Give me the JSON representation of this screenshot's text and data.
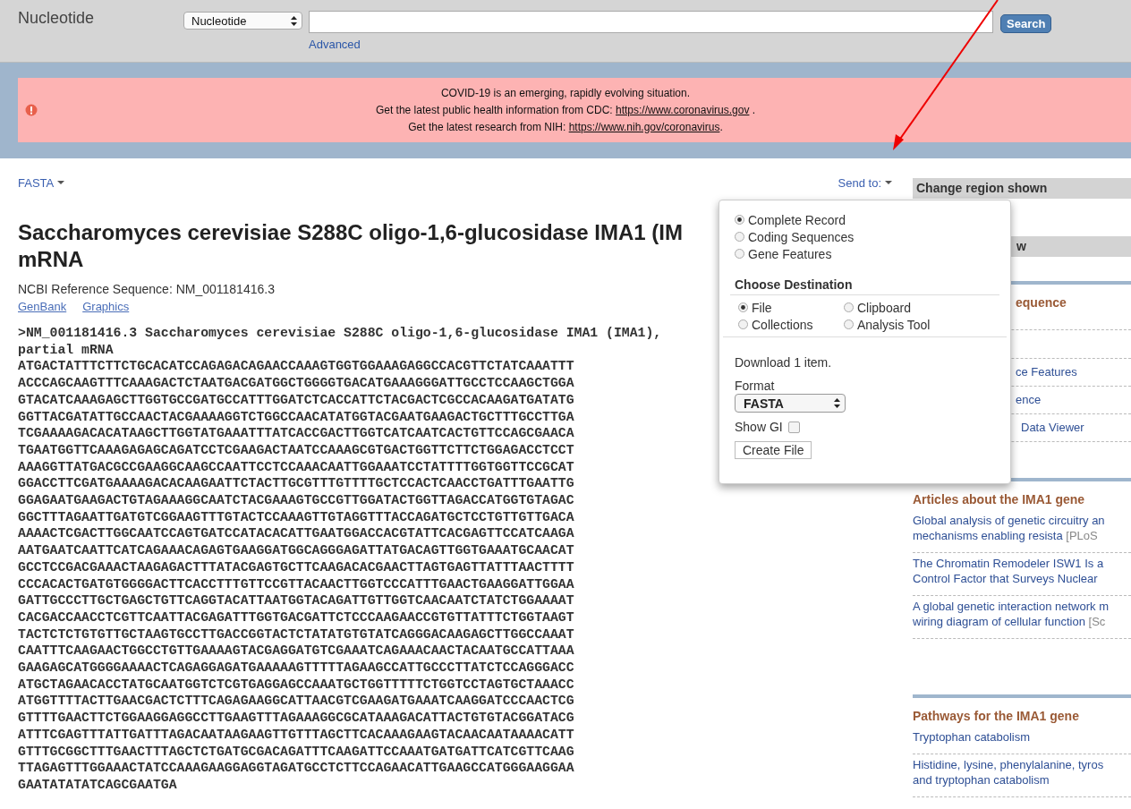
{
  "header": {
    "database": "Nucleotide",
    "db_select": "Nucleotide",
    "search_button": "Search",
    "advanced_link": "Advanced"
  },
  "alert": {
    "lines": [
      {
        "text": "COVID-19 is an emerging, rapidly evolving situation."
      },
      {
        "text": "Get the latest public health information from CDC: ",
        "link": "https://www.coronavirus.gov",
        "tail": " ."
      },
      {
        "text": "Get the latest research from NIH: ",
        "link": "https://www.nih.gov/coronavirus",
        "tail": "."
      }
    ]
  },
  "toolbar": {
    "format_menu": "FASTA",
    "send_to": "Send to:"
  },
  "record": {
    "title_lines": [
      "Saccharomyces cerevisiae S288C oligo-1,6-glucosidase IMA1 (IM",
      "mRNA"
    ],
    "reference": "NCBI Reference Sequence: NM_001181416.3",
    "links": [
      "GenBank",
      "Graphics"
    ],
    "fasta_header": [
      ">NM_001181416.3 Saccharomyces cerevisiae S288C oligo-1,6-glucosidase IMA1 (IMA1),",
      "partial mRNA"
    ],
    "sequence": [
      "ATGACTATTTCTTCTGCACATCCAGAGACAGAACCAAAGTGGTGGAAAGAGGCCACGTTCTATCAAATTT",
      "ACCCAGCAAGTTTCAAAGACTCTAATGACGATGGCTGGGGTGACATGAAAGGGATTGCCTCCAAGCTGGA",
      "GTACATCAAAGAGCTTGGTGCCGATGCCATTTGGATCTCACCATTCTACGACTCGCCACAAGATGATATG",
      "GGTTACGATATTGCCAACTACGAAAAGGTCTGGCCAACATATGGTACGAATGAAGACTGCTTTGCCTTGA",
      "TCGAAAAGACACATAAGCTTGGTATGAAATTTATCACCGACTTGGTCATCAATCACTGTTCCAGCGAACA",
      "TGAATGGTTCAAAGAGAGCAGATCCTCGAAGACTAATCCAAAGCGTGACTGGTTCTTCTGGAGACCTCCT",
      "AAAGGTTATGACGCCGAAGGCAAGCCAATTCCTCCAAACAATTGGAAATCCTATTTTGGTGGTTCCGCAT",
      "GGACCTTCGATGAAAAGACACAAGAATTCTACTTGCGTTTGTTTTGCTCCACTCAACCTGATTTGAATTG",
      "GGAGAATGAAGACTGTAGAAAGGCAATCTACGAAAGTGCCGTTGGATACTGGTTAGACCATGGTGTAGAC",
      "GGCTTTAGAATTGATGTCGGAAGTTTGTACTCCAAAGTTGTAGGTTTACCAGATGCTCCTGTTGTTGACA",
      "AAAACTCGACTTGGCAATCCAGTGATCCATACACATTGAATGGACCACGTATTCACGAGTTCCATCAAGA",
      "AATGAATCAATTCATCAGAAACAGAGTGAAGGATGGCAGGGAGATTATGACAGTTGGTGAAATGCAACAT",
      "GCCTCCGACGAAACTAAGAGACTTTATACGAGTGCTTCAAGACACGAACTTAGTGAGTTATTTAACTTTT",
      "CCCACACTGATGTGGGGACTTCACCTTTGTTCCGTTACAACTTGGTCCCATTTGAACTGAAGGATTGGAA",
      "GATTGCCCTTGCTGAGCTGTTCAGGTACATTAATGGTACAGATTGTTGGTCAACAATCTATCTGGAAAAT",
      "CACGACCAACCTCGTTCAATTACGAGATTTGGTGACGATTCTCCCAAGAACCGTGTTATTTCTGGTAAGT",
      "TACTCTCTGTGTTGCTAAGTGCCTTGACCGGTACTCTATATGTGTATCAGGGACAAGAGCTTGGCCAAAT",
      "CAATTTCAAGAACTGGCCTGTTGAAAAGTACGAGGATGTCGAAATCAGAAACAACTACAATGCCATTAAA",
      "GAAGAGCATGGGGAAAACTCAGAGGAGATGAAAAAGTTTTTAGAAGCCATTGCCCTTATCTCCAGGGACC",
      "ATGCTAGAACACCTATGCAATGGTCTCGTGAGGAGCCAAATGCTGGTTTTTCTGGTCCTAGTGCTAAACC",
      "ATGGTTTTACTTGAACGACTCTTTCAGAGAAGGCATTAACGTCGAAGATGAAATCAAGGATCCCAACTCG",
      "GTTTTGAACTTCTGGAAGGAGGCCTTGAAGTTTAGAAAGGCGCATAAAGACATTACTGTGTACGGATACG",
      "ATTTCGAGTTTATTGATTTAGACAATAAGAAGTTGTTTAGCTTCACAAAGAAGTACAACAATAAAACATT",
      "GTTTGCGGCTTTGAACTTTAGCTCTGATGCGACAGATTTCAAGATTCCAAATGATGATTCATCGTTCAAG",
      "TTAGAGTTTGGAAACTATCCAAAGAAGGAGGTAGATGCCTCTTCCAGAACATTGAAGCCATGGGAAGGAA",
      "GAATATATATCAGCGAATGA"
    ]
  },
  "send_popup": {
    "record_options": [
      {
        "label": "Complete Record",
        "selected": true
      },
      {
        "label": "Coding Sequences",
        "selected": false
      },
      {
        "label": "Gene Features",
        "selected": false
      }
    ],
    "destination_heading": "Choose Destination",
    "destinations": [
      {
        "label": "File",
        "selected": true
      },
      {
        "label": "Clipboard",
        "selected": false
      },
      {
        "label": "Collections",
        "selected": false
      },
      {
        "label": "Analysis Tool",
        "selected": false
      }
    ],
    "download_text": "Download 1 item.",
    "format_label": "Format",
    "format_value": "FASTA",
    "show_gi": {
      "label": "Show GI",
      "checked": false
    },
    "create_button": "Create File"
  },
  "sidebar": {
    "sections": [
      {
        "kind": "grey",
        "title": "Change region shown"
      },
      {
        "kind": "grey",
        "title": "w"
      },
      {
        "kind": "covered",
        "title": "equence",
        "items": [
          {
            "text": "ce Features"
          },
          {
            "text": "ence"
          },
          {
            "text": "Data Viewer"
          }
        ]
      },
      {
        "kind": "links",
        "title": "Articles about the IMA1 gene",
        "items": [
          {
            "lines": [
              "Global analysis of genetic circuitry an",
              "mechanisms enabling resista"
            ],
            "source": "[PLoS"
          },
          {
            "lines": [
              "The Chromatin Remodeler ISW1 Is a",
              "Control Factor that Surveys Nuclear"
            ]
          },
          {
            "lines": [
              "A global genetic interaction network m",
              "wiring diagram of cellular function"
            ],
            "source": "[Sc"
          }
        ]
      },
      {
        "kind": "links",
        "title": "Pathways for the IMA1 gene",
        "items": [
          {
            "lines": [
              "Tryptophan catabolism"
            ]
          },
          {
            "lines": [
              "Histidine, lysine, phenylalanine, tyros",
              "and tryptophan catabolism"
            ]
          }
        ]
      }
    ]
  }
}
